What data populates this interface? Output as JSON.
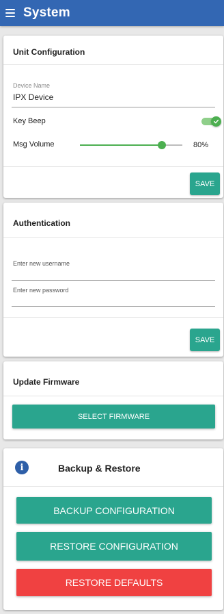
{
  "appbar": {
    "title": "System",
    "menu_icon": "hamburger-menu-icon",
    "color": "#3367b3"
  },
  "unit_config": {
    "title": "Unit Configuration",
    "device_name_label": "Device Name",
    "device_name_value": "IPX Device",
    "key_beep_label": "Key Beep",
    "key_beep_on": true,
    "msg_volume_label": "Msg Volume",
    "msg_volume_value": 80,
    "msg_volume_text": "80%",
    "save_label": "SAVE"
  },
  "authentication": {
    "title": "Authentication",
    "username_placeholder": "Enter new username",
    "password_placeholder": "Enter new password",
    "save_label": "SAVE"
  },
  "firmware": {
    "title": "Update Firmware",
    "select_label": "SELECT FIRMWARE"
  },
  "backup": {
    "title": "Backup & Restore",
    "info_icon": "info-icon",
    "backup_label": "BACKUP CONFIGURATION",
    "restore_label": "RESTORE CONFIGURATION",
    "defaults_label": "RESTORE DEFAULTS"
  },
  "colors": {
    "accent": "#2aa58e",
    "danger": "#f04141",
    "toggle_on": "#4caf50"
  }
}
